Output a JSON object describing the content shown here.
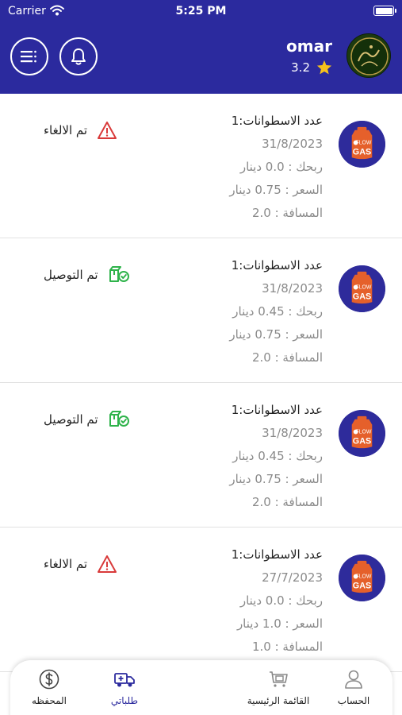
{
  "status_bar": {
    "carrier": "Carrier",
    "time": "5:25 PM"
  },
  "header": {
    "user_name": "omar",
    "rating": "3.2"
  },
  "orders": [
    {
      "count": "عدد الاسطوانات:1",
      "date": "31/8/2023",
      "profit": "ربحك : 0.0 دينار",
      "price": "السعر : 0.75 دينار",
      "distance": "المسافة : 2.0",
      "status": "تم الالغاء",
      "status_type": "cancelled"
    },
    {
      "count": "عدد الاسطوانات:1",
      "date": "31/8/2023",
      "profit": "ربحك : 0.45 دينار",
      "price": "السعر : 0.75 دينار",
      "distance": "المسافة : 2.0",
      "status": "تم التوصيل",
      "status_type": "delivered"
    },
    {
      "count": "عدد الاسطوانات:1",
      "date": "31/8/2023",
      "profit": "ربحك : 0.45 دينار",
      "price": "السعر : 0.75 دينار",
      "distance": "المسافة : 2.0",
      "status": "تم التوصيل",
      "status_type": "delivered"
    },
    {
      "count": "عدد الاسطوانات:1",
      "date": "27/7/2023",
      "profit": "ربحك : 0.0 دينار",
      "price": "السعر : 1.0 دينار",
      "distance": "المسافة : 1.0",
      "status": "تم الالغاء",
      "status_type": "cancelled"
    }
  ],
  "logo_text": {
    "top": "FLOW",
    "bottom": "GAS"
  },
  "bottom_nav": {
    "wallet": "المحفظه",
    "my_orders": "طلباتي",
    "main_menu": "القائمة الرئيسية",
    "account": "الحساب"
  },
  "colors": {
    "primary": "#2b2a9e",
    "cancelled": "#d93a3a",
    "delivered": "#2fb34b",
    "star": "#f6c21c"
  },
  "icons": {
    "menu": "menu-icon",
    "bell": "bell-icon",
    "star": "star-icon",
    "cancelled": "warning-icon",
    "delivered": "package-check-icon",
    "wallet": "dollar-circle-icon",
    "orders": "delivery-truck-icon",
    "main_menu": "cart-icon",
    "account": "user-icon"
  }
}
